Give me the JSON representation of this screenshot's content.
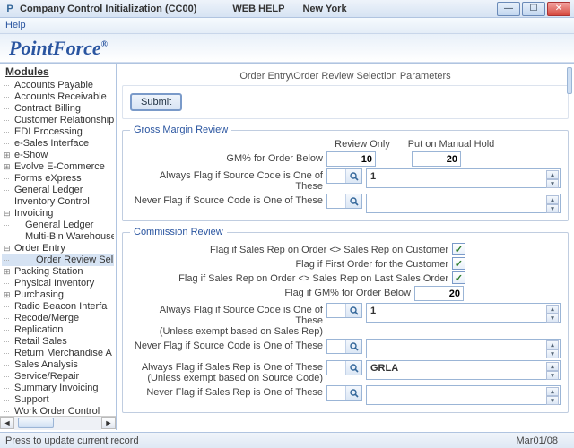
{
  "titlebar": {
    "title": "Company Control Initialization (CC00)",
    "link1": "WEB HELP",
    "link2": "New York"
  },
  "menubar": {
    "help": "Help"
  },
  "brand": {
    "name": "PointForce",
    "reg": "®"
  },
  "sidebar": {
    "header": "Modules",
    "items": [
      "Accounts Payable",
      "Accounts Receivable",
      "Contract Billing",
      "Customer Relationship",
      "EDI Processing",
      "e-Sales Interface",
      "e-Show",
      "Evolve E-Commerce",
      "Forms eXpress",
      "General Ledger",
      "Inventory Control",
      "Invoicing",
      "General Ledger",
      "Multi-Bin Warehouse",
      "Order Entry",
      "Order Review Sel",
      "Packing Station",
      "Physical Inventory",
      "Purchasing",
      "Radio Beacon Interfa",
      "Recode/Merge",
      "Replication",
      "Retail Sales",
      "Return Merchandise A",
      "Sales Analysis",
      "Service/Repair",
      "Summary Invoicing",
      "Support",
      "Work Order Control"
    ]
  },
  "page": {
    "title": "Order Entry\\Order Review Selection Parameters",
    "submit": "Submit"
  },
  "gm": {
    "legend": "Gross Margin Review",
    "col_review": "Review Only",
    "col_hold": "Put on Manual Hold",
    "row1": "GM% for Order Below",
    "v1": "10",
    "v2": "20",
    "row2": "Always Flag if Source Code is One of These",
    "area2": "1",
    "row3": "Never Flag if Source Code is One of These",
    "area3": ""
  },
  "cr": {
    "legend": "Commission Review",
    "chk1": "Flag if Sales Rep on Order <> Sales Rep on Customer",
    "chk2": "Flag if First Order for the Customer",
    "chk3": "Flag if Sales Rep on Order <> Sales Rep on Last Sales Order",
    "row_gm": "Flag if GM% for Order Below",
    "gm_val": "20",
    "row_a1": "Always Flag if Source Code is One of These",
    "row_a1b": "(Unless exempt based on Sales Rep)",
    "area_a1": "1",
    "row_n1": "Never Flag if Source Code is One of These",
    "area_n1": "",
    "row_a2": "Always Flag if Sales Rep is One of These",
    "row_a2b": "(Unless exempt based on Source Code)",
    "area_a2": "GRLA",
    "row_n2": "Never Flag if Sales Rep is One of These",
    "area_n2": ""
  },
  "status": {
    "msg": "Press to update current record",
    "date": "Mar01/08"
  },
  "glyphs": {
    "min": "—",
    "max": "☐",
    "close": "✕",
    "left": "◄",
    "right": "►",
    "up": "▴",
    "down": "▾",
    "check": "✓"
  }
}
